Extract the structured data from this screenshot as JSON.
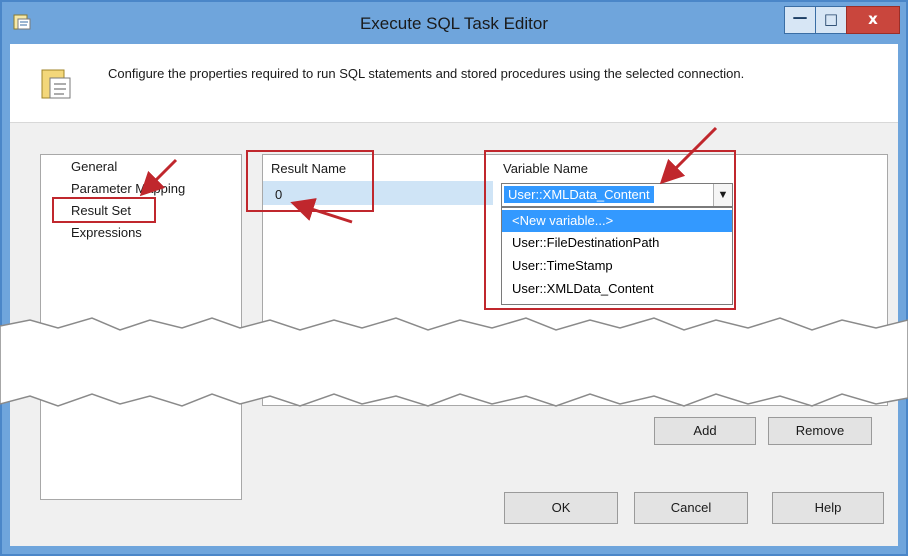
{
  "window": {
    "title": "Execute SQL Task Editor",
    "controls": {
      "minimize": "—",
      "maximize": "□",
      "close": "x"
    }
  },
  "header": {
    "description": "Configure the properties required to run SQL statements and stored procedures using the selected connection."
  },
  "nav": {
    "items": [
      {
        "label": "General"
      },
      {
        "label": "Parameter Mapping"
      },
      {
        "label": "Result Set",
        "selected": true
      },
      {
        "label": "Expressions"
      }
    ]
  },
  "result_grid": {
    "columns": {
      "result_name": "Result Name",
      "variable_name": "Variable Name"
    },
    "row": {
      "result_name": "0",
      "variable_name": "User::XMLData_Content"
    },
    "dropdown_options": [
      "<New variable...>",
      "User::FileDestinationPath",
      "User::TimeStamp",
      "User::XMLData_Content"
    ]
  },
  "buttons": {
    "add": "Add",
    "remove": "Remove",
    "ok": "OK",
    "cancel": "Cancel",
    "help": "Help"
  },
  "colors": {
    "titlebar": "#6fa5dc",
    "selection": "#3399ff",
    "annotation": "#c0272d"
  }
}
